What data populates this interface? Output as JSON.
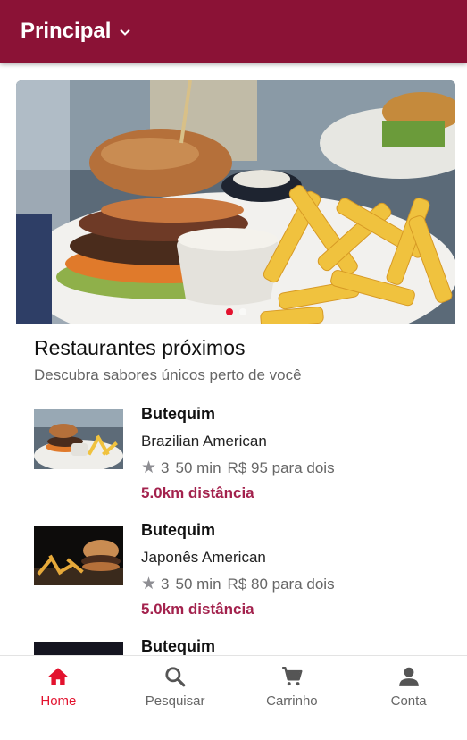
{
  "appbar": {
    "title": "Principal"
  },
  "banner": {
    "dots": 2,
    "active_dot": 0
  },
  "section": {
    "title": "Restaurantes próximos",
    "subtitle": "Descubra sabores únicos perto de você"
  },
  "restaurants": [
    {
      "name": "Butequim",
      "cuisine": "Brazilian American",
      "rating": "3",
      "time": "50 min",
      "price": "R$ 95 para dois",
      "distance": "5.0km distância"
    },
    {
      "name": "Butequim",
      "cuisine": "Japonês American",
      "rating": "3",
      "time": "50 min",
      "price": "R$ 80 para dois",
      "distance": "5.0km distância"
    },
    {
      "name": "Butequim"
    }
  ],
  "nav": {
    "items": [
      {
        "label": "Home",
        "icon": "home-icon",
        "active": true
      },
      {
        "label": "Pesquisar",
        "icon": "search-icon",
        "active": false
      },
      {
        "label": "Carrinho",
        "icon": "cart-icon",
        "active": false
      },
      {
        "label": "Conta",
        "icon": "account-icon",
        "active": false
      }
    ]
  },
  "colors": {
    "primary": "#8b1236",
    "accent": "#e3122e",
    "distance": "#a3224d"
  }
}
